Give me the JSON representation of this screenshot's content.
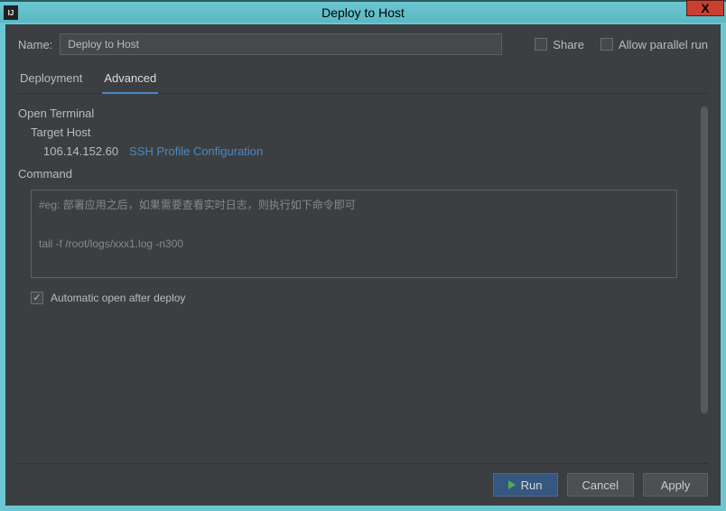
{
  "window": {
    "title": "Deploy to Host",
    "icon_char": "IJ",
    "close": "X"
  },
  "name_row": {
    "label": "Name:",
    "value": "Deploy to Host"
  },
  "options": {
    "share_label": "Share",
    "allow_parallel_label": "Allow parallel run"
  },
  "tabs": {
    "deployment": "Deployment",
    "advanced": "Advanced"
  },
  "terminal": {
    "section": "Open Terminal",
    "target_host_label": "Target Host",
    "host_ip": "106.14.152.60",
    "ssh_link": "SSH Profile Configuration",
    "command_label": "Command",
    "command_text": "#eg: 部署应用之后，如果需要查看实时日志，则执行如下命令即可\n\ntail -f /root/logs/xxx1.log -n300",
    "auto_open_label": "Automatic open after deploy"
  },
  "buttons": {
    "run": "Run",
    "cancel": "Cancel",
    "apply": "Apply"
  }
}
